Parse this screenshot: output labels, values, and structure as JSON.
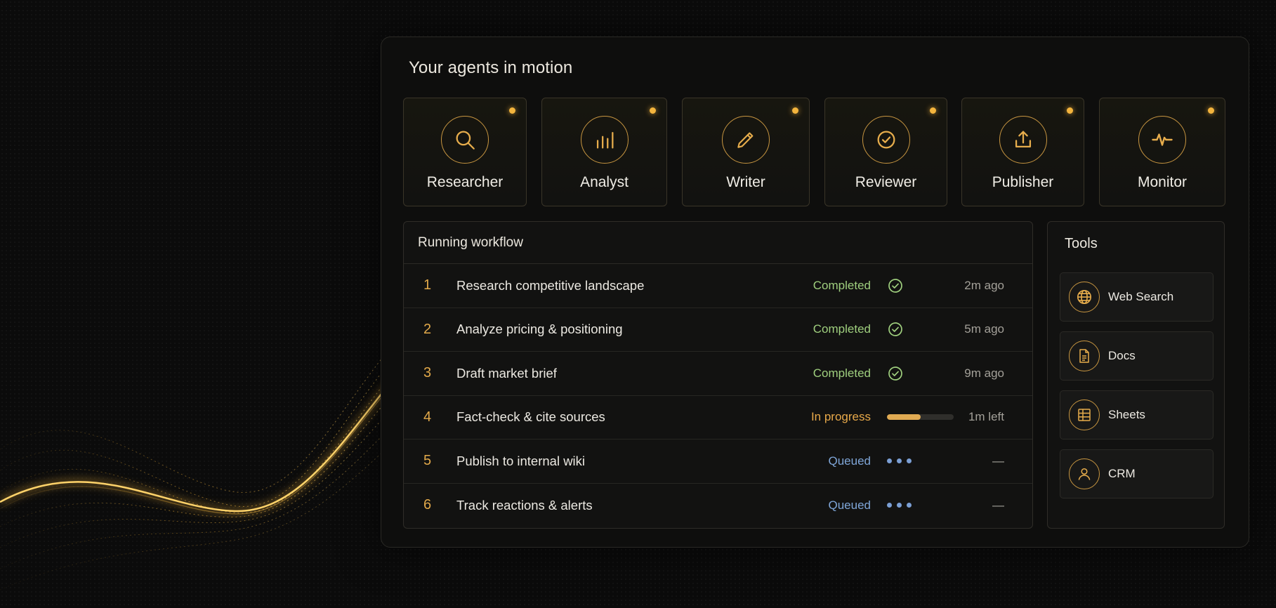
{
  "panel": {
    "title": "Your agents in motion"
  },
  "agents": [
    {
      "label": "Researcher",
      "icon": "search-icon"
    },
    {
      "label": "Analyst",
      "icon": "bar-chart-icon"
    },
    {
      "label": "Writer",
      "icon": "pencil-icon"
    },
    {
      "label": "Reviewer",
      "icon": "check-circle-icon"
    },
    {
      "label": "Publisher",
      "icon": "upload-icon"
    },
    {
      "label": "Monitor",
      "icon": "pulse-icon"
    }
  ],
  "workflow": {
    "title": "Running workflow",
    "rows": [
      {
        "num": "1",
        "task": "Research competitive landscape",
        "status": "Completed",
        "state": "completed",
        "time": "2m ago"
      },
      {
        "num": "2",
        "task": "Analyze pricing & positioning",
        "status": "Completed",
        "state": "completed",
        "time": "5m ago"
      },
      {
        "num": "3",
        "task": "Draft market brief",
        "status": "Completed",
        "state": "completed",
        "time": "9m ago"
      },
      {
        "num": "4",
        "task": "Fact-check & cite sources",
        "status": "In progress",
        "state": "progress",
        "progress": 0.5,
        "time": "1m left"
      },
      {
        "num": "5",
        "task": "Publish to internal wiki",
        "status": "Queued",
        "state": "queued",
        "time": "—"
      },
      {
        "num": "6",
        "task": "Track reactions & alerts",
        "status": "Queued",
        "state": "queued",
        "time": "—"
      }
    ]
  },
  "tools": {
    "title": "Tools",
    "items": [
      {
        "label": "Web Search",
        "icon": "globe-icon"
      },
      {
        "label": "Docs",
        "icon": "document-icon"
      },
      {
        "label": "Sheets",
        "icon": "table-icon"
      },
      {
        "label": "CRM",
        "icon": "user-icon"
      }
    ]
  },
  "colors": {
    "accent": "#f3b43d",
    "completed": "#9fcf7e",
    "in_progress": "#e8a94a",
    "queued": "#7fa6d8"
  }
}
